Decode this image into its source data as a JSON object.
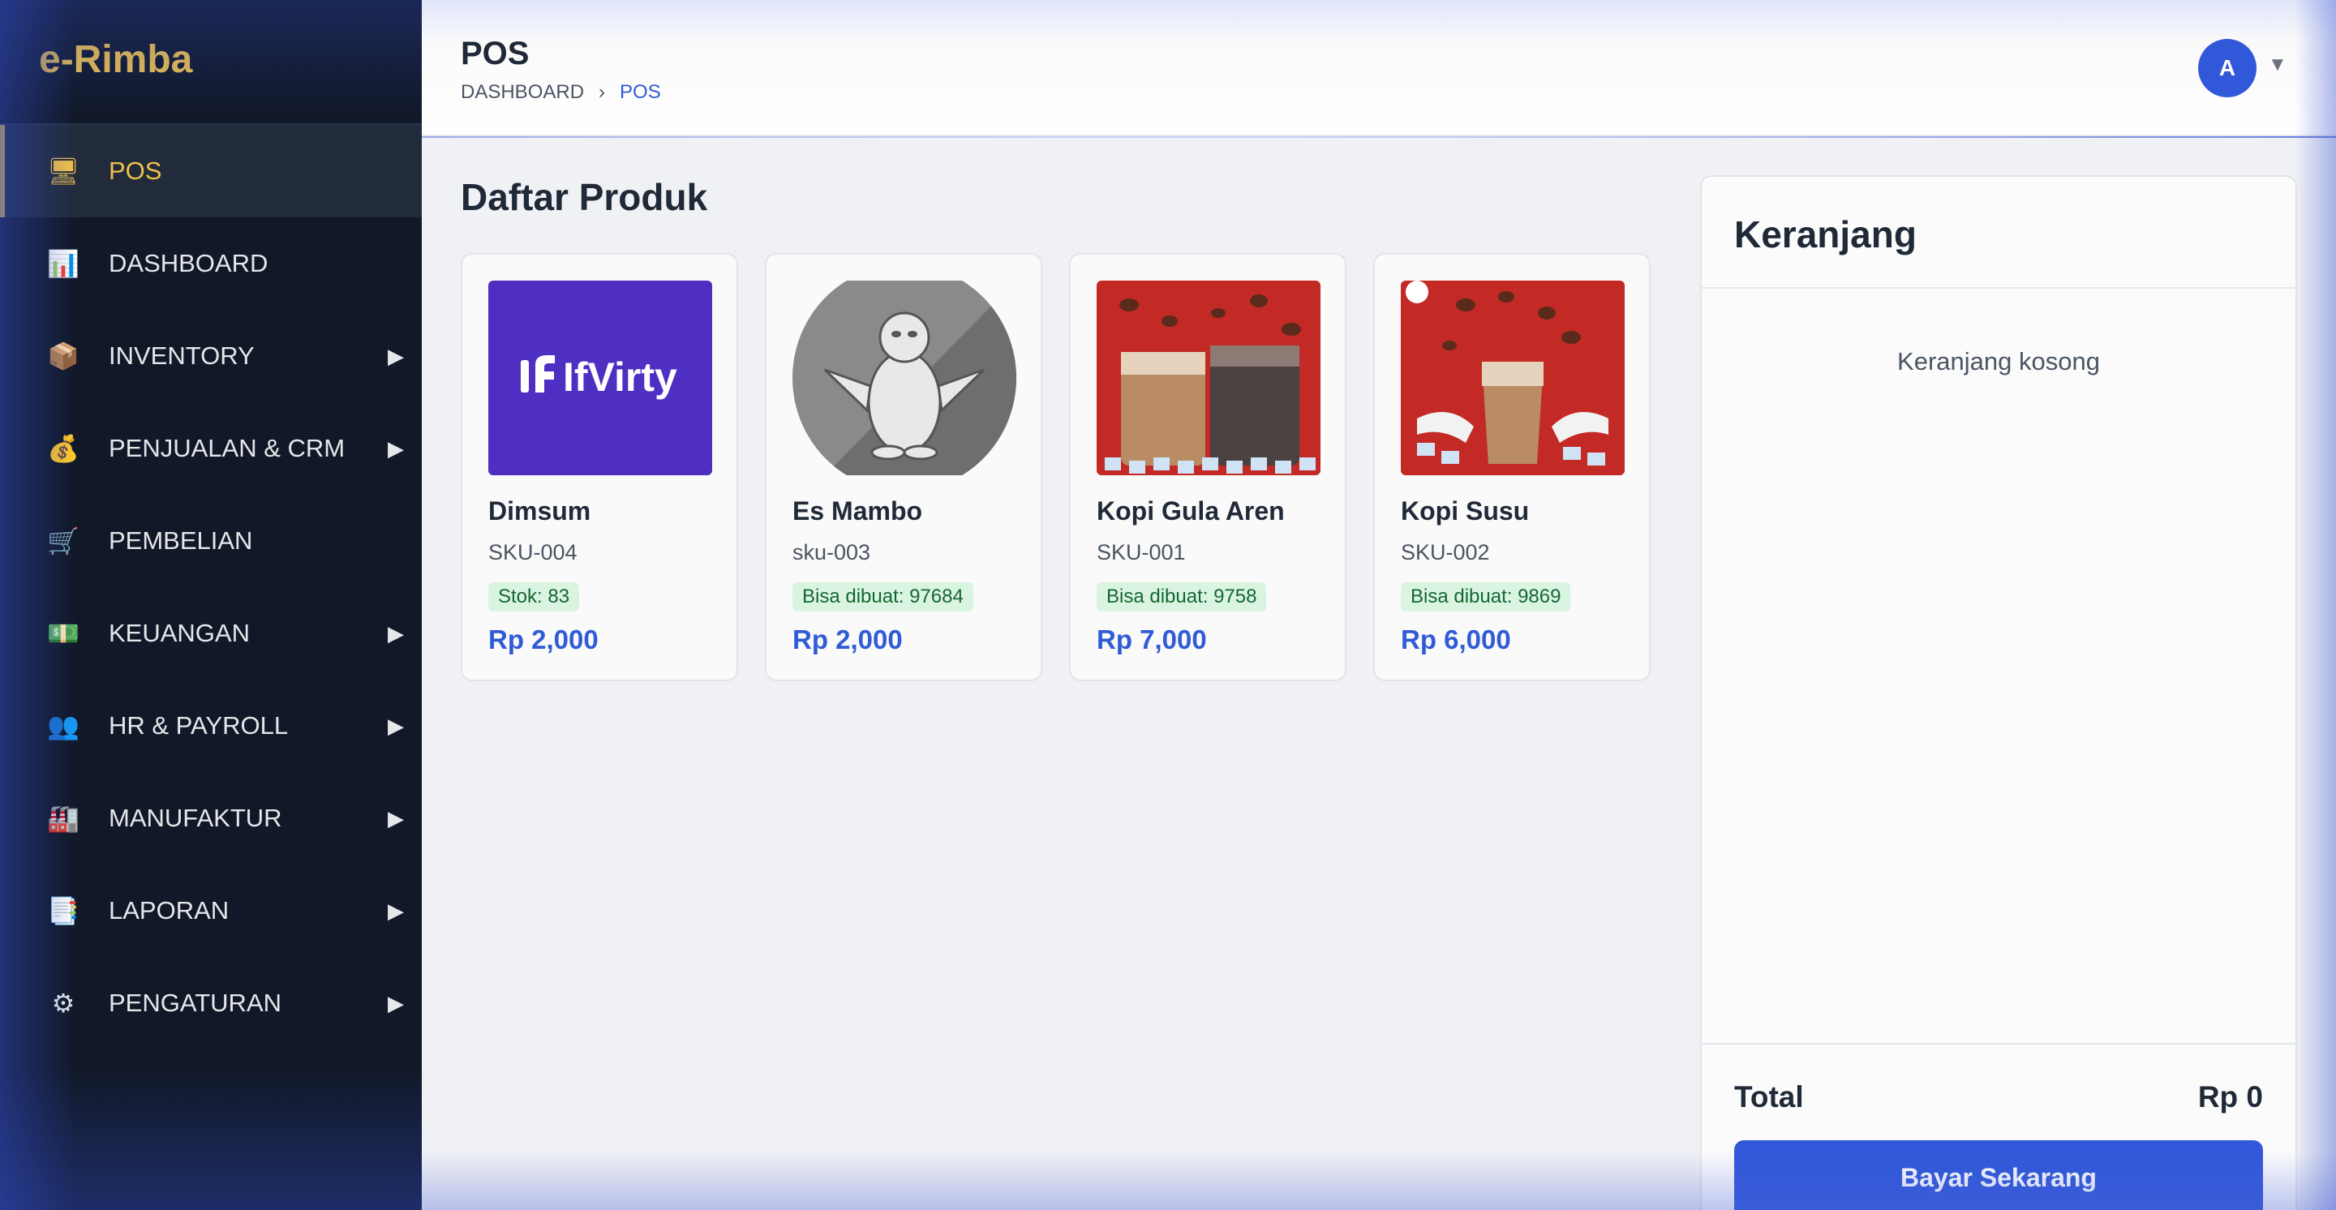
{
  "brand": "e-Rimba",
  "sidebar": {
    "items": [
      {
        "label": "POS",
        "icon": "monitor-icon",
        "glyph": "🖥",
        "active": true,
        "has_submenu": false
      },
      {
        "label": "DASHBOARD",
        "icon": "bar-chart-icon",
        "glyph": "📊",
        "active": false,
        "has_submenu": false
      },
      {
        "label": "INVENTORY",
        "icon": "package-icon",
        "glyph": "📦",
        "active": false,
        "has_submenu": true
      },
      {
        "label": "PENJUALAN & CRM",
        "icon": "money-bag-icon",
        "glyph": "💰",
        "active": false,
        "has_submenu": true
      },
      {
        "label": "PEMBELIAN",
        "icon": "cart-icon",
        "glyph": "🛒",
        "active": false,
        "has_submenu": false
      },
      {
        "label": "KEUANGAN",
        "icon": "banknote-icon",
        "glyph": "💵",
        "active": false,
        "has_submenu": true
      },
      {
        "label": "HR & PAYROLL",
        "icon": "people-icon",
        "glyph": "👥",
        "active": false,
        "has_submenu": true
      },
      {
        "label": "MANUFAKTUR",
        "icon": "factory-icon",
        "glyph": "🏭",
        "active": false,
        "has_submenu": true
      },
      {
        "label": "LAPORAN",
        "icon": "report-icon",
        "glyph": "📑",
        "active": false,
        "has_submenu": true
      },
      {
        "label": "PENGATURAN",
        "icon": "gear-icon",
        "glyph": "⚙",
        "active": false,
        "has_submenu": true
      }
    ],
    "arrow_glyph": "▶"
  },
  "header": {
    "title": "POS",
    "breadcrumb": {
      "root": "DASHBOARD",
      "separator": "›",
      "current": "POS"
    },
    "avatar_initial": "A",
    "avatar_caret": "▼"
  },
  "products": {
    "title": "Daftar Produk",
    "items": [
      {
        "name": "Dimsum",
        "sku": "SKU-004",
        "badge": "Stok: 83",
        "price": "Rp 2,000",
        "image": "ifvirty-logo",
        "image_text": "IfVirty"
      },
      {
        "name": "Es Mambo",
        "sku": "sku-003",
        "badge": "Bisa dibuat: 97684",
        "price": "Rp 2,000",
        "image": "penguin-placeholder",
        "image_text": ""
      },
      {
        "name": "Kopi Gula Aren",
        "sku": "SKU-001",
        "badge": "Bisa dibuat: 9758",
        "price": "Rp 7,000",
        "image": "coffee-two-cups-photo",
        "image_text": ""
      },
      {
        "name": "Kopi Susu",
        "sku": "SKU-002",
        "badge": "Bisa dibuat: 9869",
        "price": "Rp 6,000",
        "image": "coffee-milk-photo",
        "image_text": ""
      }
    ]
  },
  "cart": {
    "title": "Keranjang",
    "empty_text": "Keranjang kosong",
    "total_label": "Total",
    "total_value": "Rp 0",
    "pay_label": "Bayar Sekarang"
  },
  "colors": {
    "accent": "#3158d8",
    "brand": "#f0c14b",
    "sidebar": "#111827",
    "badge_bg": "#d9f5e1",
    "badge_text": "#166534"
  }
}
